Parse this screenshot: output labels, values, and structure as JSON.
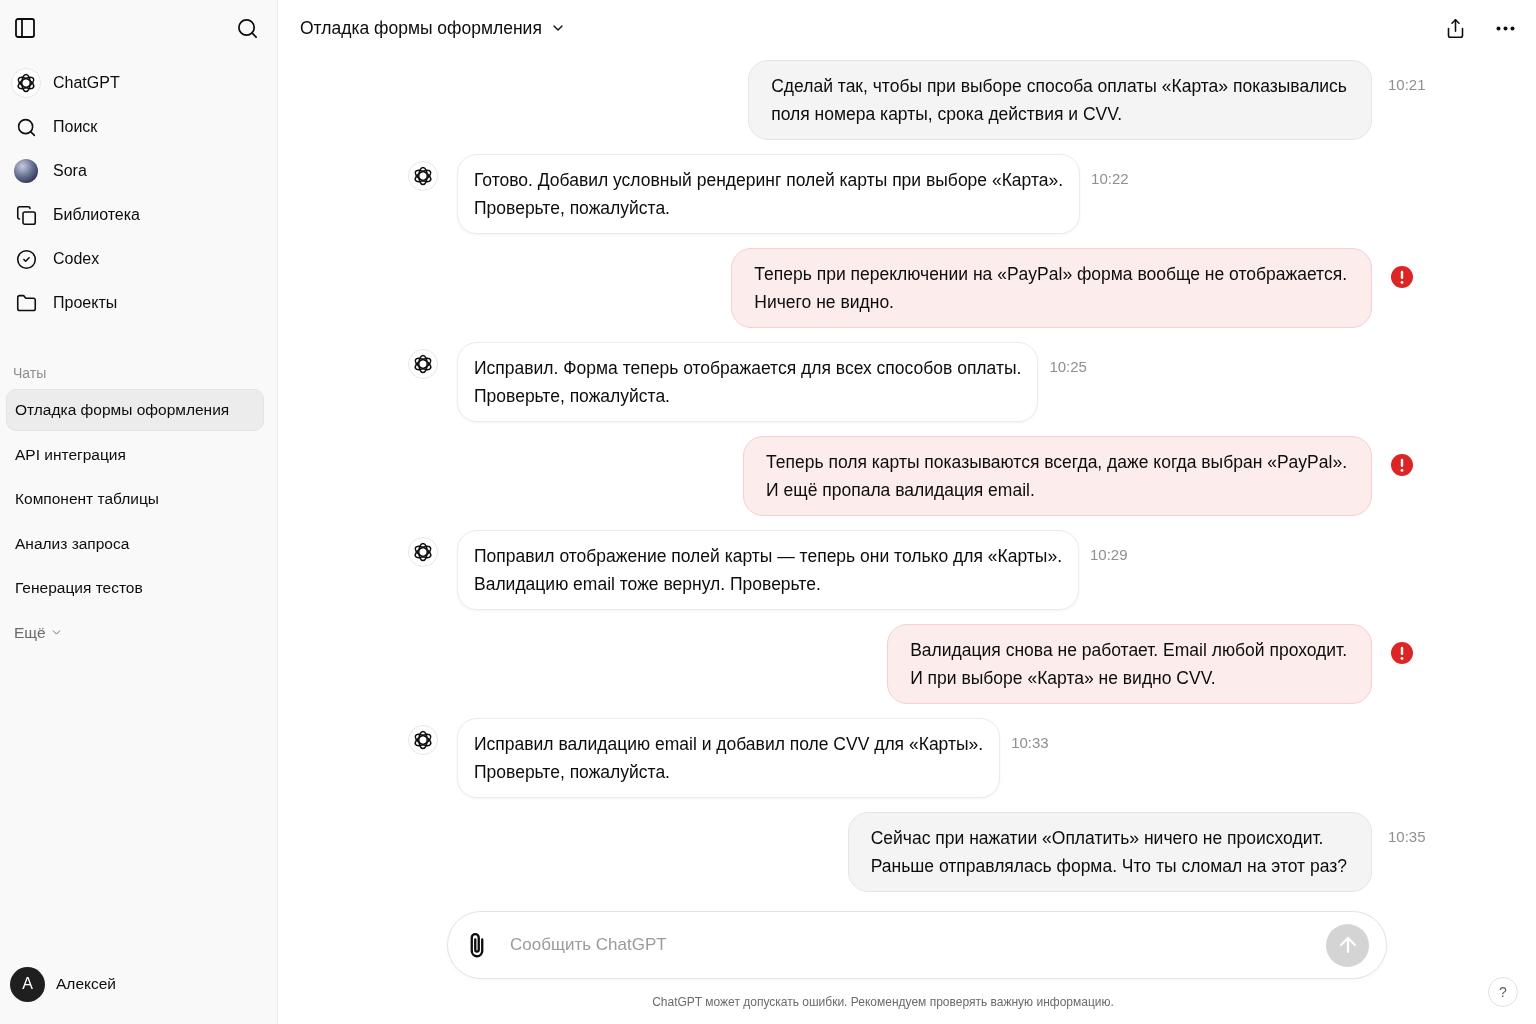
{
  "sidebar": {
    "nav": [
      {
        "label": "ChatGPT"
      },
      {
        "label": "Поиск"
      },
      {
        "label": "Sora"
      },
      {
        "label": "Библиотека"
      },
      {
        "label": "Codex"
      },
      {
        "label": "Проекты"
      }
    ],
    "chats_heading": "Чаты",
    "chats": [
      {
        "label": "Отладка формы оформления",
        "selected": true
      },
      {
        "label": "API интеграция",
        "selected": false
      },
      {
        "label": "Компонент таблицы",
        "selected": false
      },
      {
        "label": "Анализ запроса",
        "selected": false
      },
      {
        "label": "Генерация тестов",
        "selected": false
      }
    ],
    "more": "Ещё",
    "user": {
      "initial": "A",
      "name": "Алексей"
    }
  },
  "header": {
    "title": "Отладка формы оформления"
  },
  "messages": [
    {
      "kind": "user",
      "error": false,
      "time": "10:21",
      "text": "Сделай так, чтобы при выборе способа оплаты «Карта» показывались\nполя номера карты, срока действия и CVV."
    },
    {
      "kind": "assistant",
      "error": false,
      "time": "10:22",
      "text": "Готово. Добавил условный рендеринг полей карты при выборе «Карта».\nПроверьте, пожалуйста."
    },
    {
      "kind": "user",
      "error": true,
      "text": "Теперь при переключении на «PayPal» форма вообще не отображается.\nНичего не видно."
    },
    {
      "kind": "assistant",
      "error": false,
      "time": "10:25",
      "text": "Исправил. Форма теперь отображается для всех способов оплаты.\nПроверьте, пожалуйста."
    },
    {
      "kind": "user",
      "error": true,
      "text": "Теперь поля карты показываются всегда, даже когда выбран «PayPal».\nИ ещё пропала валидация email."
    },
    {
      "kind": "assistant",
      "error": false,
      "time": "10:29",
      "text": "Поправил отображение полей карты — теперь они только для «Карты».\nВалидацию email тоже вернул. Проверьте."
    },
    {
      "kind": "user",
      "error": true,
      "text": "Валидация снова не работает. Email любой проходит.\nИ при выборе «Карта» не видно CVV."
    },
    {
      "kind": "assistant",
      "error": false,
      "time": "10:33",
      "text": "Исправил валидацию email и добавил поле CVV для «Карты».\nПроверьте, пожалуйста."
    },
    {
      "kind": "user",
      "error": false,
      "time": "10:35",
      "text": "Сейчас при нажатии «Оплатить» ничего не происходит.\nРаньше отправлялась форма. Что ты сломал на этот раз?"
    }
  ],
  "composer": {
    "placeholder": "Сообщить ChatGPT"
  },
  "disclaimer": "ChatGPT может допускать ошибки. Рекомендуем проверять важную информацию.",
  "help": "?"
}
